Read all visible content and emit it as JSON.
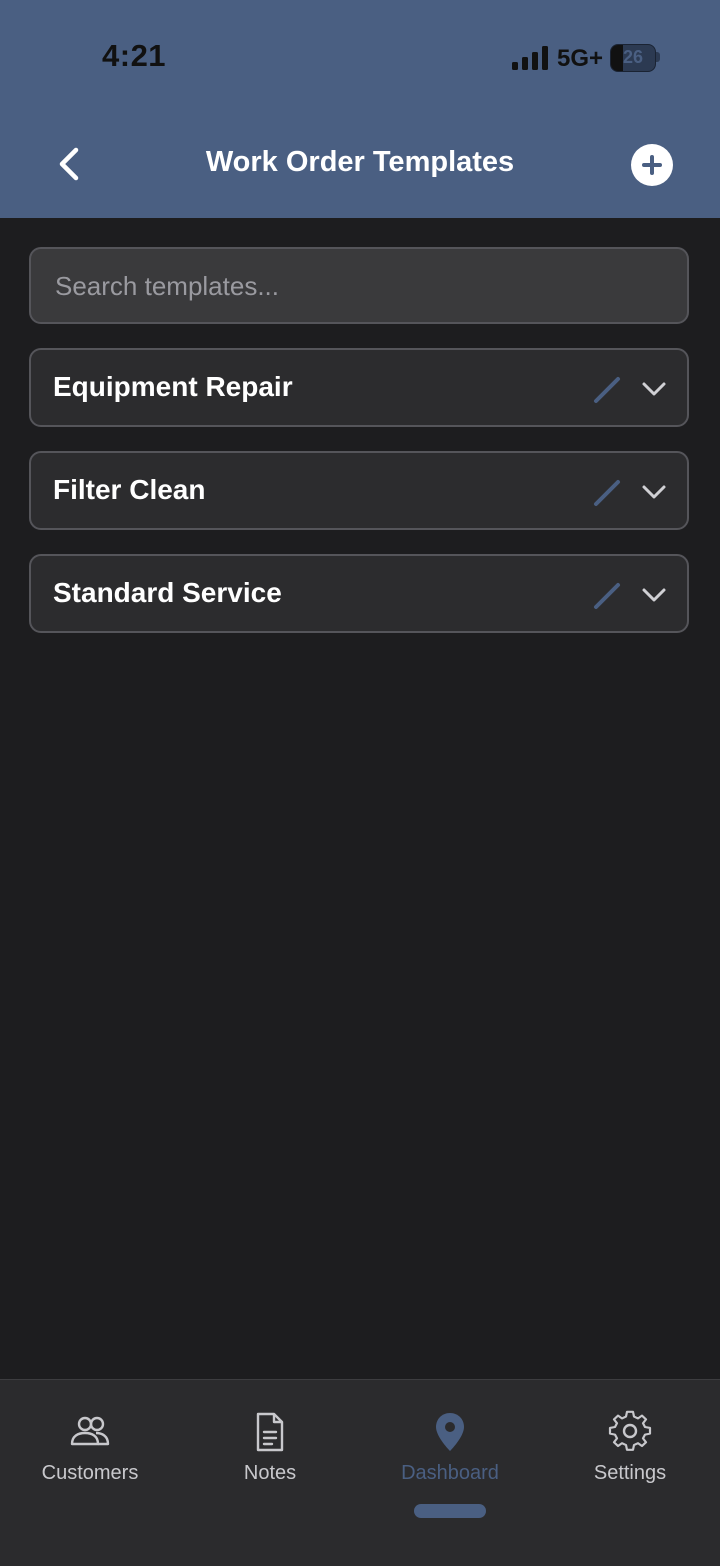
{
  "status_bar": {
    "time": "4:21",
    "network": "5G+",
    "battery": "26"
  },
  "header": {
    "title": "Work Order Templates",
    "back_icon": "chevron-left-icon",
    "add_icon": "plus-icon"
  },
  "search": {
    "placeholder": "Search templates...",
    "value": ""
  },
  "templates": [
    {
      "name": "Equipment Repair"
    },
    {
      "name": "Filter Clean"
    },
    {
      "name": "Standard Service"
    }
  ],
  "tabs": [
    {
      "label": "Customers",
      "icon": "people-icon",
      "active": false
    },
    {
      "label": "Notes",
      "icon": "document-icon",
      "active": false
    },
    {
      "label": "Dashboard",
      "icon": "map-pin-icon",
      "active": true
    },
    {
      "label": "Settings",
      "icon": "gear-icon",
      "active": false
    }
  ],
  "colors": {
    "header": "#4a5f82",
    "background": "#1d1d1f",
    "card": "#2c2c2e",
    "accent": "#4a5f82"
  }
}
